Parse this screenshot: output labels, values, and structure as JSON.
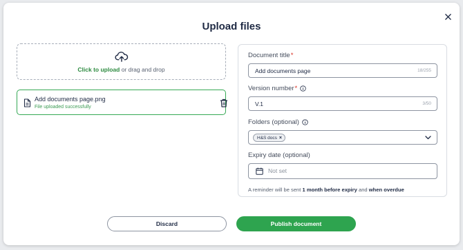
{
  "modal": {
    "title": "Upload files",
    "close_icon": "close-icon"
  },
  "dropzone": {
    "icon": "cloud-upload-icon",
    "action_text": "Click to upload",
    "rest_text": " or drag and drop"
  },
  "file": {
    "icon": "file-icon",
    "name": "Add documents page.png",
    "status": "File uploaded successfully",
    "delete_icon": "trash-icon"
  },
  "form": {
    "document_title": {
      "label": "Document title",
      "required_mark": "*",
      "value": "Add documents page",
      "counter": "18/255"
    },
    "version_number": {
      "label": "Version number",
      "required_mark": "*",
      "info_icon": "info-icon",
      "value": "V.1",
      "counter": "3/50"
    },
    "folders": {
      "label": "Folders (optional)",
      "info_icon": "info-icon",
      "chips": [
        "H&S docs"
      ],
      "chip_remove": "×",
      "dropdown_icon": "chevron-down-icon"
    },
    "expiry_date": {
      "label": "Expiry date (optional)",
      "icon": "calendar-icon",
      "placeholder": "Not set"
    },
    "reminder": {
      "prefix": "A reminder will be sent ",
      "bold1": "1 month before expiry",
      "middle": " and ",
      "bold2": "when overdue"
    }
  },
  "buttons": {
    "discard": "Discard",
    "publish": "Publish document"
  },
  "colors": {
    "accent_green": "#2ea44f",
    "link_green": "#2c8a3f",
    "required_red": "#d93025",
    "text_dark": "#1f2a44"
  }
}
